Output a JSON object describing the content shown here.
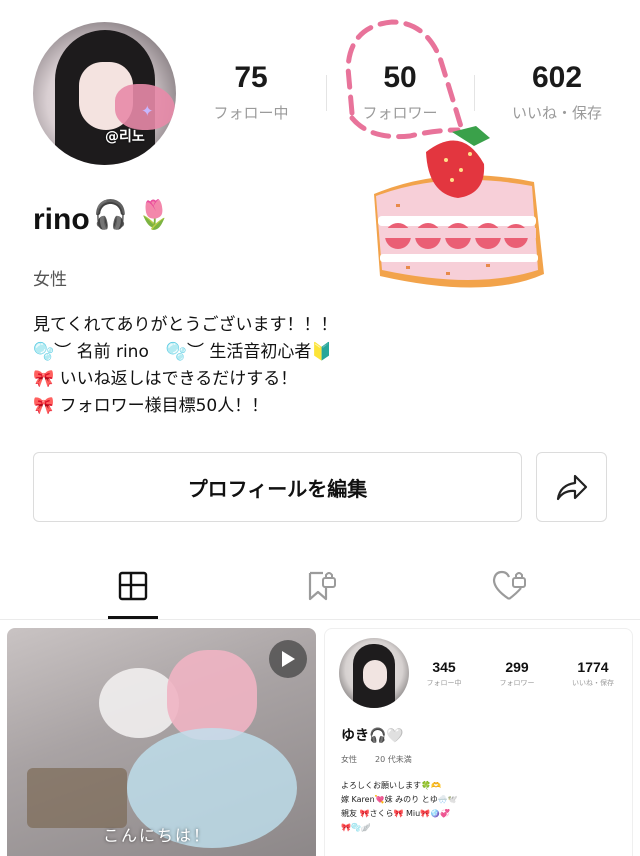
{
  "profile": {
    "avatar_tag": "@리노",
    "name": "rino",
    "name_emoji": "🎧 🌷",
    "gender": "女性",
    "bio": [
      "見てくれてありがとうございます！！！",
      "🫧︶ 名前 rino　🫧︶ 生活音初心者🔰",
      "🎀 いいね返しはできるだけする！",
      "🎀 フォロワー様目標50人！！"
    ]
  },
  "stats": {
    "following": {
      "value": "75",
      "label": "フォロー中"
    },
    "followers": {
      "value": "50",
      "label": "フォロワー"
    },
    "likes": {
      "value": "602",
      "label": "いいね・保存"
    }
  },
  "actions": {
    "edit_label": "プロフィールを編集",
    "share_icon": "share-arrow-icon"
  },
  "tabs": [
    {
      "id": "posts",
      "icon": "grid-icon",
      "active": true
    },
    {
      "id": "saved",
      "icon": "bookmark-lock-icon",
      "active": false
    },
    {
      "id": "liked",
      "icon": "heart-lock-icon",
      "active": false
    }
  ],
  "posts": [
    {
      "type": "video",
      "caption": "こんにちは！",
      "icon": "play-icon"
    },
    {
      "type": "image",
      "mini_profile": {
        "name": "ゆき🎧🤍",
        "gender": "女性",
        "age": "20 代未満",
        "stats": [
          {
            "value": "345",
            "label": "フォロー中"
          },
          {
            "value": "299",
            "label": "フォロワー"
          },
          {
            "value": "1774",
            "label": "いいね・保存"
          }
        ],
        "bio": [
          "よろしくお願いします🍀🫶",
          "嫁 Karen💘妹 みのり とゆ🌨️🕊️",
          "親友 🎀さくら🎀 Miu🎀🪩💞",
          "🎀🫧🪽"
        ]
      }
    }
  ],
  "colors": {
    "accent_pink": "#e8739a",
    "text_primary": "#111111",
    "text_secondary": "#9b9b9b",
    "border": "#dcdcdc"
  }
}
